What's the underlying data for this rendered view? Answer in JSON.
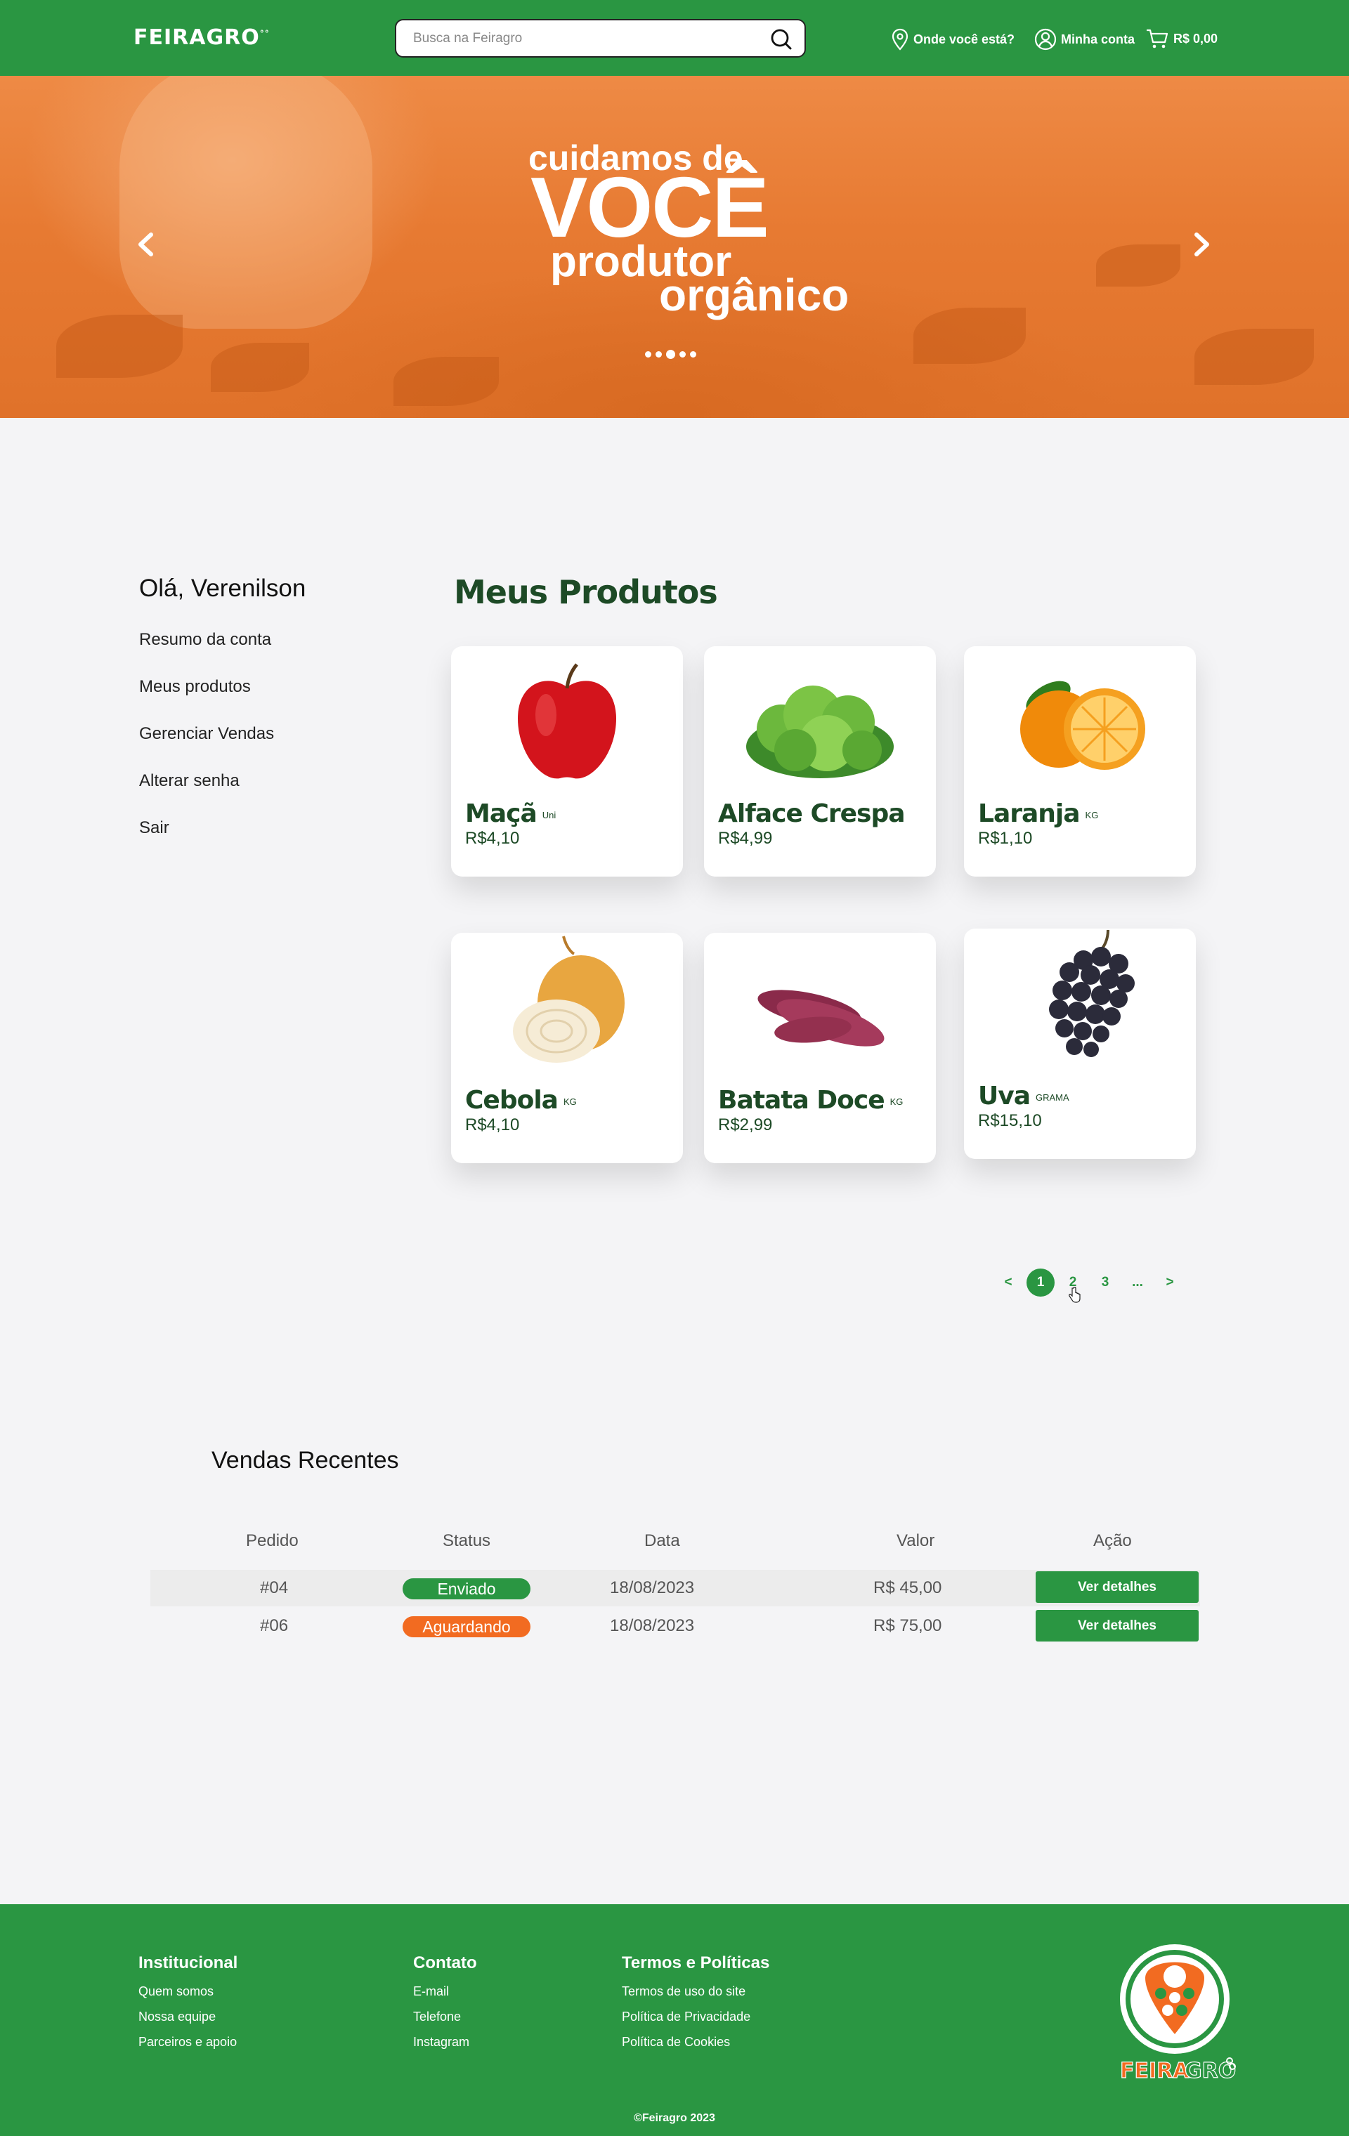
{
  "header": {
    "logo": "FEIRAGRO",
    "search_placeholder": "Busca na Feiragro",
    "location": "Onde você está?",
    "account": "Minha conta",
    "cart_total": "R$ 0,00"
  },
  "hero": {
    "line1": "cuidamos de",
    "line2": "VOCÊ",
    "line3": "produtor",
    "line4": "orgânico"
  },
  "sidebar": {
    "greeting": "Olá, Verenilson",
    "items": [
      "Resumo da conta",
      "Meus produtos",
      "Gerenciar Vendas",
      "Alterar senha",
      "Sair"
    ]
  },
  "products": {
    "title": "Meus Produtos",
    "items": [
      {
        "name": "Maçã",
        "unit": "Uni",
        "price": "R$4,10",
        "icon": "apple-image"
      },
      {
        "name": "Alface Crespa",
        "unit": "",
        "price": "R$4,99",
        "icon": "lettuce-image"
      },
      {
        "name": "Laranja",
        "unit": "KG",
        "price": "R$1,10",
        "icon": "orange-image"
      },
      {
        "name": "Cebola",
        "unit": "KG",
        "price": "R$4,10",
        "icon": "onion-image"
      },
      {
        "name": "Batata Doce",
        "unit": "KG",
        "price": "R$2,99",
        "icon": "sweet-potato-image"
      },
      {
        "name": "Uva",
        "unit": "GRAMA",
        "price": "R$15,10",
        "icon": "grape-image"
      }
    ]
  },
  "pagination": {
    "prev": "<",
    "pages": [
      "1",
      "2",
      "3",
      "..."
    ],
    "next": ">",
    "current": "1"
  },
  "sales": {
    "title": "Vendas Recentes",
    "headers": [
      "Pedido",
      "Status",
      "Data",
      "Valor",
      "Ação"
    ],
    "rows": [
      {
        "order": "#04",
        "status": "Enviado",
        "date": "18/08/2023",
        "value": "R$ 45,00",
        "action": "Ver detalhes"
      },
      {
        "order": "#06",
        "status": "Aguardando",
        "date": "18/08/2023",
        "value": "R$ 75,00",
        "action": "Ver detalhes"
      }
    ]
  },
  "footer": {
    "institucional": {
      "title": "Institucional",
      "links": [
        "Quem somos",
        "Nossa equipe",
        "Parceiros e apoio"
      ]
    },
    "contato": {
      "title": "Contato",
      "links": [
        "E-mail",
        "Telefone",
        "Instagram"
      ]
    },
    "termos": {
      "title": "Termos e Políticas",
      "links": [
        "Termos de uso do site",
        "Política de Privacidade",
        "Política de Cookies"
      ]
    },
    "logo": "FEIRAGRO",
    "copyright": "©Feiragro 2023"
  },
  "colors": {
    "brand_green": "#2a9642",
    "dark_green": "#1d4a26",
    "orange": "#f26b21",
    "row_highlight": "#ececec"
  }
}
